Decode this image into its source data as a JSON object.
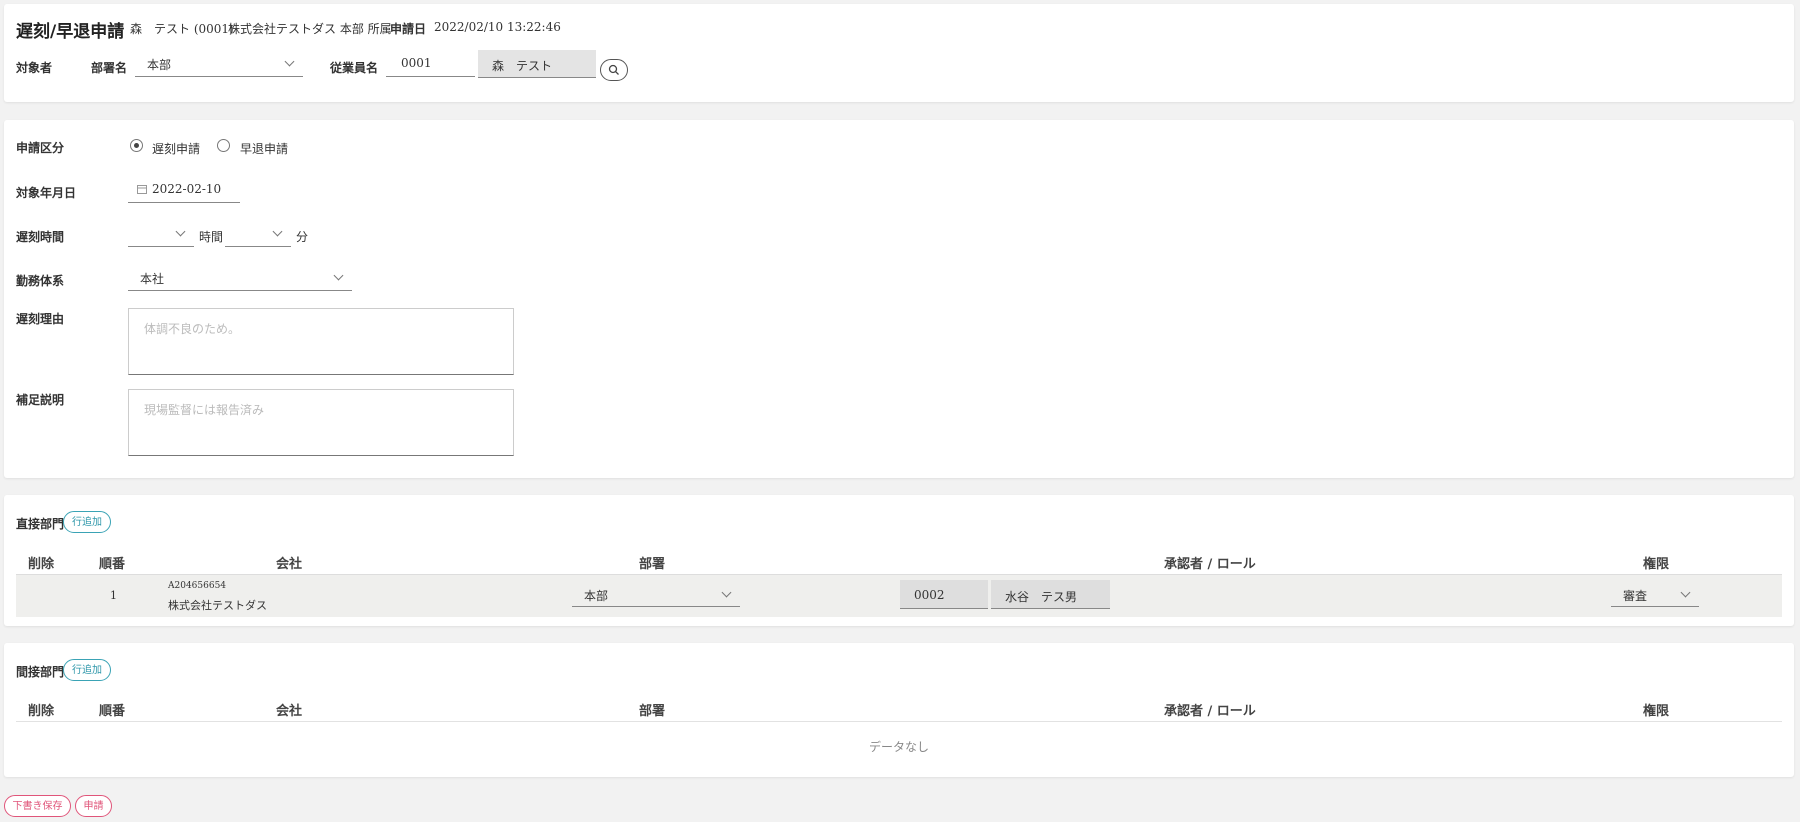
{
  "header": {
    "title": "遅刻/早退申請",
    "applicant": "森　テスト (0001)",
    "affiliation": "株式会社テストダス 本部 所属",
    "apply_date_label": "申請日",
    "apply_date": "2022/02/10 13:22:46",
    "target_label": "対象者",
    "dept_label": "部署名",
    "dept_value": "本部",
    "employee_label": "従業員名",
    "employee_code": "0001",
    "employee_name": "森　テスト"
  },
  "form": {
    "type_label": "申請区分",
    "type_options": [
      "遅刻申請",
      "早退申請"
    ],
    "type_selected": "遅刻申請",
    "date_label": "対象年月日",
    "date_value": "2022-02-10",
    "late_time_label": "遅刻時間",
    "hours_unit": "時間",
    "minutes_unit": "分",
    "hours_value": "",
    "minutes_value": "",
    "work_system_label": "勤務体系",
    "work_system_value": "本社",
    "reason_label": "遅刻理由",
    "reason_placeholder": "体調不良のため。",
    "note_label": "補足説明",
    "note_placeholder": "現場監督には報告済み"
  },
  "direct": {
    "section_label": "直接部門",
    "add_row_label": "行追加",
    "columns": [
      "削除",
      "順番",
      "会社",
      "部署",
      "承認者 / ロール",
      "権限"
    ],
    "rows": [
      {
        "order": "1",
        "company_code": "A204656654",
        "company_name": "株式会社テストダス",
        "dept": "本部",
        "approver_code": "0002",
        "approver_name": "水谷　テス男",
        "authority": "審査"
      }
    ]
  },
  "indirect": {
    "section_label": "間接部門",
    "add_row_label": "行追加",
    "columns": [
      "削除",
      "順番",
      "会社",
      "部署",
      "承認者 / ロール",
      "権限"
    ],
    "empty_text": "データなし"
  },
  "footer": {
    "draft_label": "下書き保存",
    "submit_label": "申請"
  },
  "colors": {
    "accent_teal": "#3aa3b5",
    "accent_pink": "#e0557a"
  }
}
